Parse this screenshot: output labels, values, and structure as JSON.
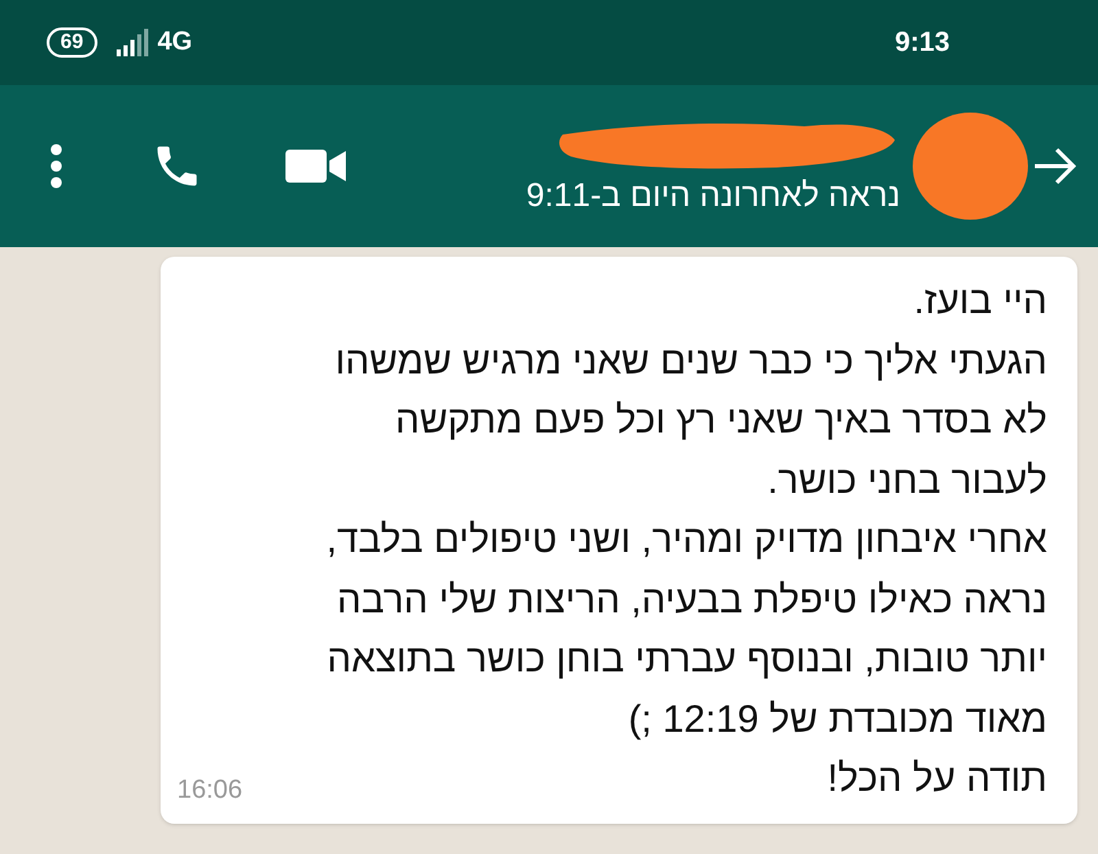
{
  "status_bar": {
    "battery": "69",
    "network": "4G",
    "time": "9:13"
  },
  "header": {
    "subtitle": "נראה לאחרונה היום ב-9:11"
  },
  "message": {
    "lines": [
      "היי בועז.",
      "הגעתי אליך כי כבר שנים שאני מרגיש שמשהו",
      "לא בסדר באיך שאני רץ וכל פעם מתקשה",
      "לעבור בחני כושר.",
      "אחרי איבחון מדויק ומהיר, ושני טיפולים בלבד,",
      "נראה כאילו טיפלת בבעיה, הריצות שלי הרבה",
      "יותר טובות, ובנוסף עברתי בוחן כושר בתוצאה",
      "מאוד מכובדת של 12:19 ;)",
      "תודה על הכל!"
    ],
    "time": "16:06"
  }
}
